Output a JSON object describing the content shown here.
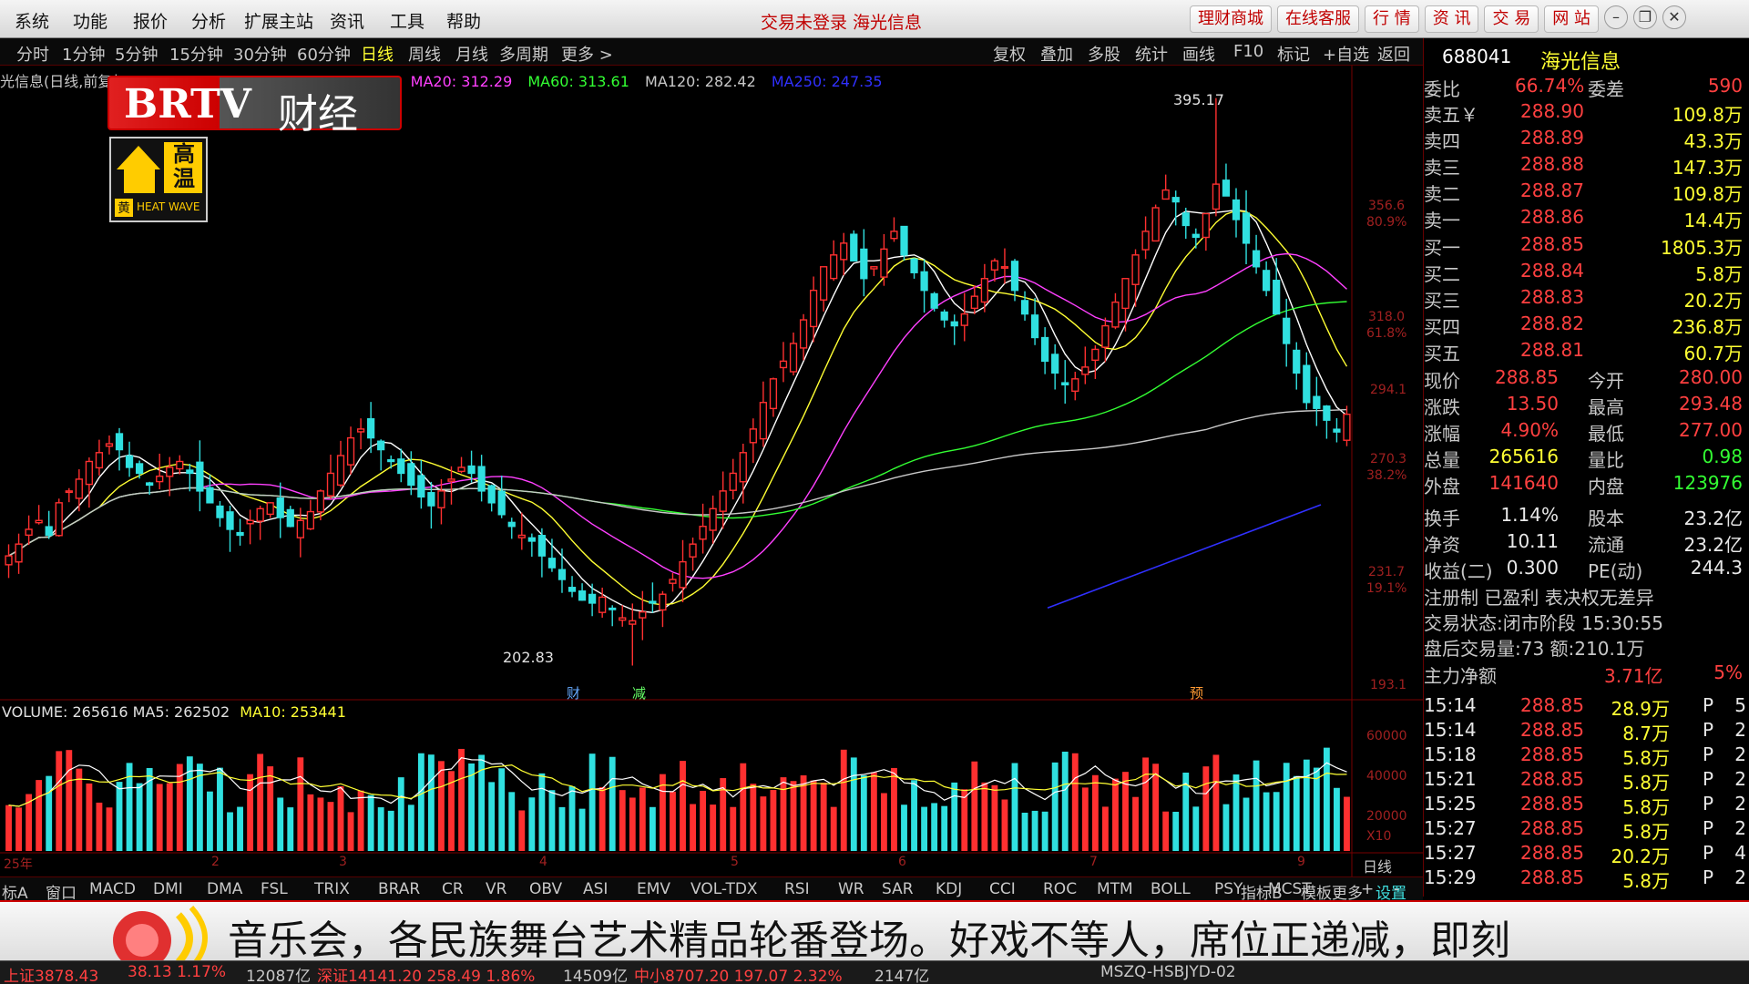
{
  "menu": {
    "items": [
      "系统",
      "功能",
      "报价",
      "分析",
      "扩展主站",
      "资讯",
      "工具",
      "帮助"
    ],
    "status_title": "交易未登录  海光信息",
    "buttons": [
      "理财商城",
      "在线客服",
      "行 情",
      "资 讯",
      "交 易",
      "网 站"
    ]
  },
  "period_bar": {
    "items": [
      "分时",
      "1分钟",
      "5分钟",
      "15分钟",
      "30分钟",
      "60分钟",
      "日线",
      "周线",
      "月线",
      "多周期",
      "更多 >"
    ],
    "active": "日线",
    "tools": [
      "复权",
      "叠加",
      "多股",
      "统计",
      "画线",
      "F10",
      "标记",
      "+自选",
      "返回"
    ]
  },
  "kline": {
    "title": "光信息(日线,前复权)",
    "ma_labels": [
      {
        "text": "MA20: 312.29",
        "color": "#ff40ff"
      },
      {
        "text": "MA60: 313.61",
        "color": "#33ff33"
      },
      {
        "text": "MA120: 282.42",
        "color": "#c8c8c8"
      },
      {
        "text": "MA250: 247.35",
        "color": "#3030ff"
      }
    ],
    "high_label": "395.17",
    "low_label": "202.83",
    "event_marks": [
      "财",
      "减",
      "预"
    ],
    "price_ticks": [
      "356.6",
      "80.9%",
      "318.0",
      "61.8%",
      "294.1",
      "270.3",
      "38.2%",
      "231.7",
      "19.1%",
      "193.1"
    ],
    "volume_title": "VOLUME: 265616  MA5: 262502",
    "volume_ma10": "MA10: 253441",
    "volume_ticks": [
      "60000",
      "40000",
      "20000",
      "X10"
    ],
    "month_labels": [
      "25年",
      "2",
      "3",
      "4",
      "5",
      "6",
      "7",
      "9"
    ],
    "period_tag": "日线"
  },
  "chart_data": {
    "type": "candlestick",
    "title": "光信息(日线,前复权)",
    "ylim": [
      193.1,
      400
    ],
    "annotations": {
      "high": 395.17,
      "low": 202.83
    },
    "ma": {
      "MA20": 312.29,
      "MA60": 313.61,
      "MA120": 282.42,
      "MA250": 247.35
    },
    "close": [
      240,
      244,
      249,
      252,
      247,
      258,
      262,
      266,
      272,
      275,
      278,
      276,
      270,
      268,
      264,
      267,
      270,
      272,
      268,
      262,
      258,
      253,
      249,
      247,
      252,
      256,
      258,
      253,
      250,
      252,
      255,
      262,
      268,
      274,
      280,
      283,
      280,
      276,
      272,
      268,
      264,
      260,
      257,
      262,
      266,
      270,
      268,
      262,
      258,
      254,
      250,
      247,
      245,
      240,
      236,
      232,
      228,
      225,
      224,
      226,
      222,
      219,
      218,
      221,
      224,
      227,
      232,
      238,
      244,
      250,
      256,
      262,
      268,
      275,
      283,
      292,
      300,
      306,
      312,
      320,
      330,
      338,
      342,
      346,
      340,
      334,
      338,
      344,
      350,
      342,
      336,
      330,
      324,
      320,
      318,
      322,
      328,
      334,
      340,
      338,
      330,
      322,
      314,
      306,
      302,
      298,
      300,
      304,
      310,
      318,
      326,
      334,
      342,
      350,
      358,
      364,
      360,
      352,
      348,
      356,
      366,
      362,
      354,
      346,
      338,
      330,
      322,
      312,
      302,
      292,
      290,
      286,
      282,
      288
    ]
  },
  "volume_data": {
    "ma5": 262502,
    "ma10": 253441,
    "last": 265616
  },
  "quote": {
    "code": "688041",
    "name": "海光信息",
    "ratio_label": "委比",
    "ratio": "66.74%",
    "diff_label": "委差",
    "diff": "590",
    "asks": [
      {
        "label": "卖五￥",
        "price": "288.90",
        "vol": "109.8万"
      },
      {
        "label": "卖四",
        "price": "288.89",
        "vol": "43.3万"
      },
      {
        "label": "卖三",
        "price": "288.88",
        "vol": "147.3万"
      },
      {
        "label": "卖二",
        "price": "288.87",
        "vol": "109.8万"
      },
      {
        "label": "卖一",
        "price": "288.86",
        "vol": "14.4万"
      }
    ],
    "bids": [
      {
        "label": "买一",
        "price": "288.85",
        "vol": "1805.3万"
      },
      {
        "label": "买二",
        "price": "288.84",
        "vol": "5.8万"
      },
      {
        "label": "买三",
        "price": "288.83",
        "vol": "20.2万"
      },
      {
        "label": "买四",
        "price": "288.82",
        "vol": "236.8万"
      },
      {
        "label": "买五",
        "price": "288.81",
        "vol": "60.7万"
      }
    ],
    "stats": [
      {
        "l1": "现价",
        "v1": "288.85",
        "c1": "red",
        "l2": "今开",
        "v2": "280.00",
        "c2": "red"
      },
      {
        "l1": "涨跌",
        "v1": "13.50",
        "c1": "red",
        "l2": "最高",
        "v2": "293.48",
        "c2": "red"
      },
      {
        "l1": "涨幅",
        "v1": "4.90%",
        "c1": "red",
        "l2": "最低",
        "v2": "277.00",
        "c2": "red"
      },
      {
        "l1": "总量",
        "v1": "265616",
        "c1": "yellow",
        "l2": "量比",
        "v2": "0.98",
        "c2": "green"
      },
      {
        "l1": "外盘",
        "v1": "141640",
        "c1": "red",
        "l2": "内盘",
        "v2": "123976",
        "c2": "green"
      },
      {
        "l1": "换手",
        "v1": "1.14%",
        "c1": "white",
        "l2": "股本",
        "v2": "23.2亿",
        "c2": "white"
      },
      {
        "l1": "净资",
        "v1": "10.11",
        "c1": "white",
        "l2": "流通",
        "v2": "23.2亿",
        "c2": "white"
      },
      {
        "l1": "收益(二)",
        "v1": "0.300",
        "c1": "white",
        "l2": "PE(动)",
        "v2": "244.3",
        "c2": "white"
      }
    ],
    "reg_line": "注册制 已盈利 表决权无差异",
    "trade_status": "交易状态:闭市阶段 15:30:55",
    "after_hours": "盘后交易量:73  额:210.1万",
    "main_net_label": "主力净额",
    "main_net_value": "3.71亿",
    "main_net_pct": "5%",
    "ticks": [
      {
        "t": "15:14",
        "p": "288.85",
        "v": "28.9万",
        "f": "P",
        "n": "5"
      },
      {
        "t": "15:14",
        "p": "288.85",
        "v": "8.7万",
        "f": "P",
        "n": "2"
      },
      {
        "t": "15:18",
        "p": "288.85",
        "v": "5.8万",
        "f": "P",
        "n": "2"
      },
      {
        "t": "15:21",
        "p": "288.85",
        "v": "5.8万",
        "f": "P",
        "n": "2"
      },
      {
        "t": "15:25",
        "p": "288.85",
        "v": "5.8万",
        "f": "P",
        "n": "2"
      },
      {
        "t": "15:27",
        "p": "288.85",
        "v": "5.8万",
        "f": "P",
        "n": "2"
      },
      {
        "t": "15:27",
        "p": "288.85",
        "v": "20.2万",
        "f": "P",
        "n": "4"
      },
      {
        "t": "15:29",
        "p": "288.85",
        "v": "5.8万",
        "f": "P",
        "n": "2"
      }
    ]
  },
  "indicators": {
    "items": [
      "标A",
      "窗口",
      "MACD",
      "DMI",
      "DMA",
      "FSL",
      "TRIX",
      "BRAR",
      "CR",
      "VR",
      "OBV",
      "ASI",
      "EMV",
      "VOL-TDX",
      "RSI",
      "WR",
      "SAR",
      "KDJ",
      "CCI",
      "ROC",
      "MTM",
      "BOLL",
      "PSY",
      "MCST",
      "更多",
      "设置"
    ],
    "right": [
      "指标B",
      "模板",
      "+",
      "-"
    ]
  },
  "logo": {
    "brand": "BRTV",
    "channel": "财经",
    "badge_top": "高温",
    "badge_bottom": "HEAT WAVE",
    "badge_level": "黄"
  },
  "ticker": {
    "text": "音乐会，各民族舞台艺术精品轮番登场。好戏不等人，席位正递减，即刻"
  },
  "statusbar": {
    "items": [
      {
        "text": "上证3878.43",
        "color": "#ff4040"
      },
      {
        "text": "38.13  1.17%",
        "color": "#ff4040"
      },
      {
        "text": "12087亿",
        "color": "#c8c8c8"
      },
      {
        "text": "深证14141.20  258.49 1.86%",
        "color": "#ff4040"
      },
      {
        "text": "14509亿",
        "color": "#c8c8c8"
      },
      {
        "text": "中小8707.20  197.07 2.32%",
        "color": "#ff4040"
      },
      {
        "text": "2147亿",
        "color": "#c8c8c8"
      },
      {
        "text": "MSZQ-HSBJYD-02",
        "color": "#c8c8c8"
      }
    ]
  }
}
